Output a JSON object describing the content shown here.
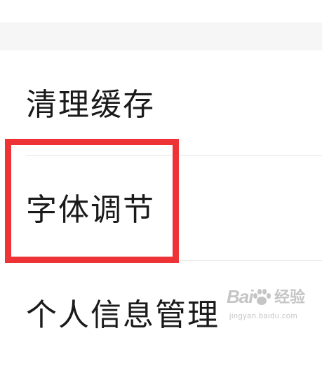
{
  "menu": {
    "items": [
      {
        "label": "清理缓存"
      },
      {
        "label": "字体调节"
      },
      {
        "label": "个人信息管理"
      }
    ]
  },
  "highlight": {
    "color": "#ee3336",
    "target": "字体调节"
  },
  "watermark": {
    "logo": "Bai",
    "brand_cn": "经验",
    "url": "jingyan.baidu.com",
    "icon": "paw-icon"
  },
  "colors": {
    "background": "#ffffff",
    "section_gap": "#f6f6f6",
    "text": "#1a1a1a",
    "divider": "#ececec"
  }
}
